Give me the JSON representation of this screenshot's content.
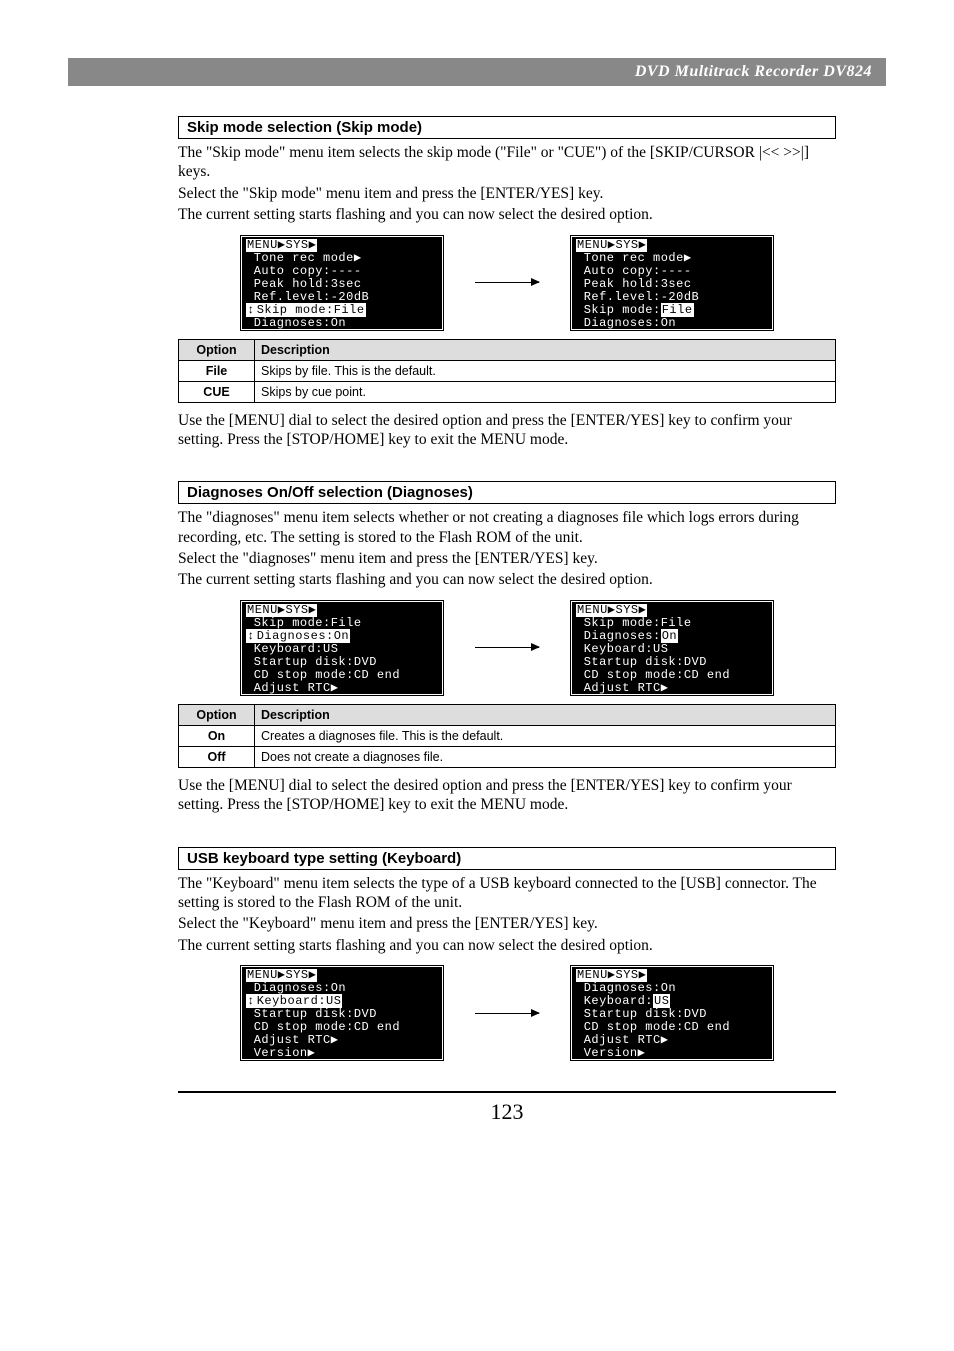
{
  "header": {
    "title": "DVD Multitrack Recorder DV824"
  },
  "footer": {
    "page": "123"
  },
  "section1": {
    "title": "Skip mode selection (Skip mode)",
    "p1": "The \"Skip mode\" menu item selects the skip mode (\"File\" or \"CUE\") of the [SKIP/CURSOR |<< >>|] keys.",
    "p2": "Select the \"Skip mode\" menu item and press the [ENTER/YES] key.",
    "p3": "The current setting starts flashing and you can now select the desired option.",
    "lcd_left": {
      "head": "MENU▶SYS▶",
      "l1": " Tone rec mode▶",
      "l2": " Auto copy:----",
      "l3": " Peak hold:3sec",
      "l4": " Ref.level:-20dB",
      "l5a": "↕",
      "l5b": "Skip mode:File",
      "l6": " Diagnoses:On"
    },
    "lcd_right": {
      "head": "MENU▶SYS▶",
      "l1": " Tone rec mode▶",
      "l2": " Auto copy:----",
      "l3": " Peak hold:3sec",
      "l4": " Ref.level:-20dB",
      "l5a": " Skip mode:",
      "l5b": "File",
      "l6": " Diagnoses:On"
    },
    "table": {
      "h1": "Option",
      "h2": "Description",
      "r1a": "File",
      "r1b": "Skips by file. This is the default.",
      "r2a": "CUE",
      "r2b": "Skips by cue point."
    },
    "confirm": "Use the [MENU] dial to select the desired option and press the [ENTER/YES] key to confirm your setting. Press the [STOP/HOME] key to exit the MENU mode."
  },
  "section2": {
    "title": "Diagnoses On/Off selection (Diagnoses)",
    "p1": "The \"diagnoses\" menu item selects whether or not creating a diagnoses file which logs errors during recording, etc. The setting is stored to the Flash ROM of the unit.",
    "p2": "Select the \"diagnoses\" menu item and press the [ENTER/YES] key.",
    "p3": "The current setting starts flashing and you can now select the desired option.",
    "lcd_left": {
      "head": "MENU▶SYS▶",
      "l1": " Skip mode:File",
      "l2a": "↕",
      "l2b": "Diagnoses:On",
      "l3": " Keyboard:US",
      "l4": " Startup disk:DVD",
      "l5": " CD stop mode:CD end",
      "l6": " Adjust RTC▶"
    },
    "lcd_right": {
      "head": "MENU▶SYS▶",
      "l1": " Skip mode:File",
      "l2a": " Diagnoses:",
      "l2b": "On",
      "l3": " Keyboard:US",
      "l4": " Startup disk:DVD",
      "l5": " CD stop mode:CD end",
      "l6": " Adjust RTC▶"
    },
    "table": {
      "h1": "Option",
      "h2": "Description",
      "r1a": "On",
      "r1b": "Creates a diagnoses file. This is the default.",
      "r2a": "Off",
      "r2b": "Does not create a diagnoses file."
    },
    "confirm": "Use the [MENU] dial to select the desired option and press the [ENTER/YES] key to confirm your setting. Press the [STOP/HOME] key to exit the MENU mode."
  },
  "section3": {
    "title": "USB keyboard type setting (Keyboard)",
    "p1": "The \"Keyboard\" menu item selects the type of a USB keyboard connected to the [USB] connector. The setting is stored to the Flash ROM of the unit.",
    "p2": "Select the \"Keyboard\" menu item and press the [ENTER/YES] key.",
    "p3": "The current setting starts flashing and you can now select the desired option.",
    "lcd_left": {
      "head": "MENU▶SYS▶",
      "l1": " Diagnoses:On",
      "l2a": "↕",
      "l2b": "Keyboard:US",
      "l3": " Startup disk:DVD",
      "l4": " CD stop mode:CD end",
      "l5": " Adjust RTC▶",
      "l6": " Version▶"
    },
    "lcd_right": {
      "head": "MENU▶SYS▶",
      "l1": " Diagnoses:On",
      "l2a": " Keyboard:",
      "l2b": "US",
      "l3": " Startup disk:DVD",
      "l4": " CD stop mode:CD end",
      "l5": " Adjust RTC▶",
      "l6": " Version▶"
    }
  }
}
